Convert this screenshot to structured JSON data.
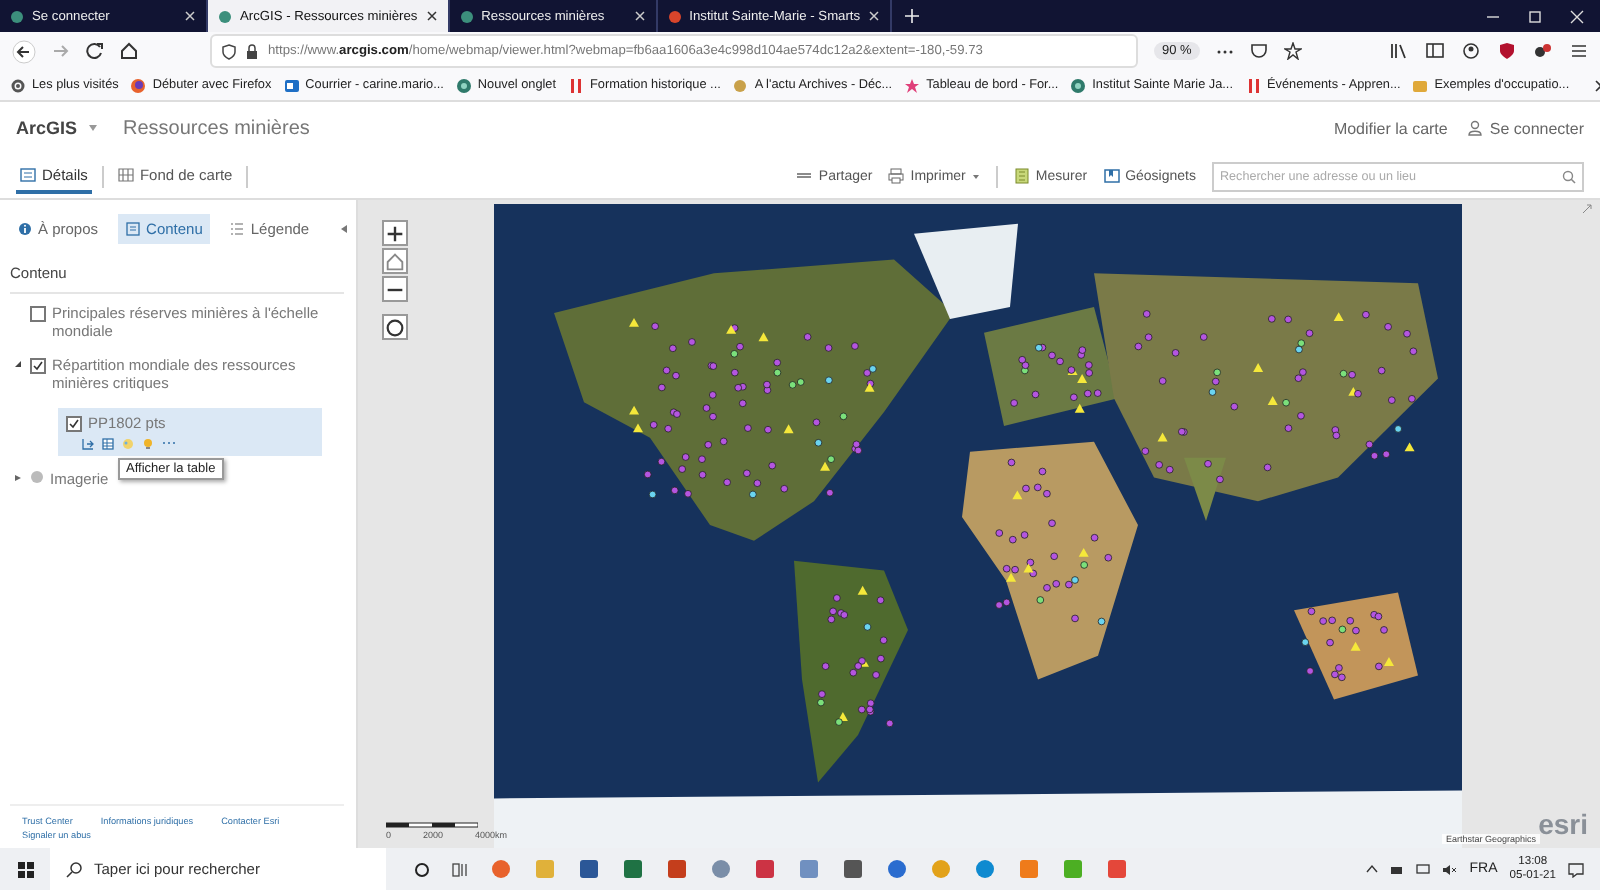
{
  "browser": {
    "tabs": [
      {
        "title": "Se connecter",
        "selected": false
      },
      {
        "title": "ArcGIS - Ressources minières",
        "selected": true
      },
      {
        "title": "Ressources minières",
        "selected": false
      },
      {
        "title": "Institut Sainte-Marie - Smarts",
        "selected": false
      }
    ],
    "url": "https://www.**arcgis.com**/home/webmap/viewer.html?webmap=fb6aa1606a3e4c998d104ae574dc12a2&extent=-180,-59.73",
    "zoom": "90 %",
    "bookmarks": [
      {
        "label": "Les plus visités",
        "kind": "gear"
      },
      {
        "label": "Débuter avec Firefox",
        "kind": "firefox"
      },
      {
        "label": "Courrier - carine.mario...",
        "kind": "mail"
      },
      {
        "label": "Nouvel onglet",
        "kind": "globe"
      },
      {
        "label": "Formation historique ...",
        "kind": "bars"
      },
      {
        "label": "A l'actu Archives - Déc...",
        "kind": "sun"
      },
      {
        "label": "Tableau de bord - For...",
        "kind": "star"
      },
      {
        "label": "Institut Sainte Marie Ja...",
        "kind": "globe"
      },
      {
        "label": "Événements - Appren...",
        "kind": "bars"
      },
      {
        "label": "Exemples d'occupatio...",
        "kind": "folder"
      }
    ]
  },
  "app": {
    "brand": "ArcGIS",
    "map_title": "Ressources minières",
    "edit_link": "Modifier la carte",
    "sign_in": "Se connecter"
  },
  "toolbar": {
    "tabs": [
      {
        "label": "Détails",
        "selected": true
      },
      {
        "label": "Fond de carte",
        "selected": false
      }
    ],
    "actions": [
      {
        "label": "Partager",
        "kind": "share"
      },
      {
        "label": "Imprimer",
        "kind": "print"
      },
      {
        "label": "Mesurer",
        "kind": "measure"
      },
      {
        "label": "Géosignets",
        "kind": "bookmark"
      }
    ],
    "search": {
      "placeholder": "Rechercher une adresse ou un lieu"
    }
  },
  "sidebar": {
    "tabs": [
      {
        "label": "À propos",
        "kind": "info",
        "selected": false
      },
      {
        "label": "Contenu",
        "kind": "content",
        "selected": true
      },
      {
        "label": "Légende",
        "kind": "legend",
        "selected": false
      }
    ],
    "heading": "Contenu",
    "layers": [
      {
        "kind": "layer",
        "name": "Principales réserves minières à l'échelle mondiale",
        "checked": false
      },
      {
        "kind": "group",
        "name": "Répartition mondiale des ressources minières critiques",
        "checked": true,
        "expanded": true,
        "children": [
          {
            "kind": "layer",
            "name": "PP1802 pts",
            "checked": true,
            "selected": true
          }
        ]
      },
      {
        "kind": "basemap",
        "name": "Imagerie",
        "expanded": false
      }
    ],
    "tooltip": "Afficher la table",
    "footer_links": [
      "Trust Center",
      "Informations juridiques",
      "Contacter Esri",
      "Signaler un abus"
    ]
  },
  "map": {
    "scale_labels": [
      "0",
      "2000",
      "4000km"
    ],
    "attribution": "Earthstar Geographics",
    "logo": "esri"
  },
  "taskbar": {
    "search_placeholder": "Taper ici pour rechercher",
    "language": "FRA",
    "time": "13:08",
    "date": "05-01-21"
  }
}
